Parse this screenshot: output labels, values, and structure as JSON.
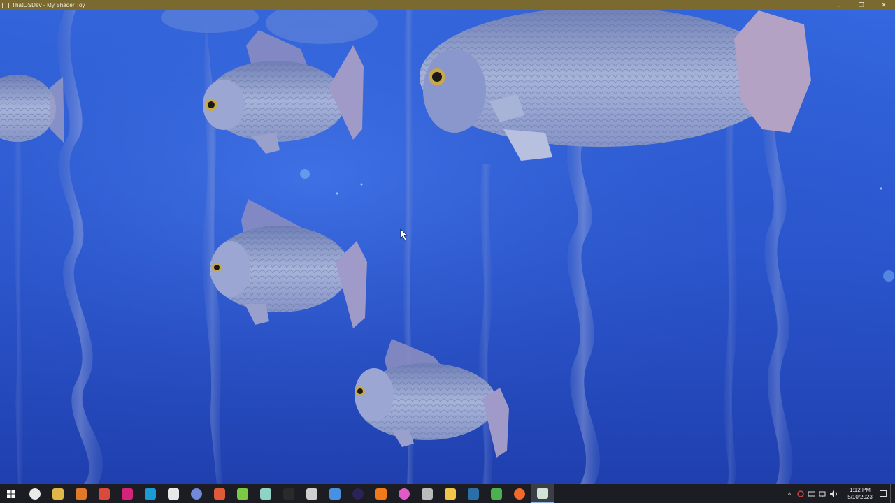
{
  "window": {
    "title": "ThatOSDev - My Shader Toy",
    "minimize_glyph": "–",
    "maximize_glyph": "❐",
    "close_glyph": "✕"
  },
  "scene": {
    "description_icon": "underwater-fish-shader",
    "colors": {
      "water_top": "#2f5ed8",
      "water_bottom": "#1e3fa8",
      "fish_body": "#7e8fc2",
      "fish_eye": "#c8a94a"
    }
  },
  "taskbar": {
    "start_icon": "windows-icon",
    "apps": [
      {
        "name": "obs-icon",
        "color": "#e9e9e9"
      },
      {
        "name": "pencil-app-icon",
        "color": "#e0b84a"
      },
      {
        "name": "blender-icon",
        "color": "#e07a2a"
      },
      {
        "name": "paint-app-icon",
        "color": "#d94a3a"
      },
      {
        "name": "m-app-icon",
        "color": "#d4237a"
      },
      {
        "name": "v-app-icon",
        "color": "#1c9ad6"
      },
      {
        "name": "excel-icon",
        "color": "#e8e8e8"
      },
      {
        "name": "discord-icon",
        "color": "#7289da"
      },
      {
        "name": "git-icon",
        "color": "#e05a3a"
      },
      {
        "name": "notepad-icon",
        "color": "#7ac843"
      },
      {
        "name": "cube-app-icon",
        "color": "#8fd3c7"
      },
      {
        "name": "terminal-icon",
        "color": "#2a2a2a"
      },
      {
        "name": "inkscape-icon",
        "color": "#cfcfcf"
      },
      {
        "name": "cmake-icon",
        "color": "#4a90e2"
      },
      {
        "name": "eclipse-icon",
        "color": "#2c2255"
      },
      {
        "name": "flame-app-icon",
        "color": "#f07a1a"
      },
      {
        "name": "color-wheel-icon",
        "color": "#e05ac8"
      },
      {
        "name": "game-controller-icon",
        "color": "#bbbbbb"
      },
      {
        "name": "file-explorer-icon",
        "color": "#f2c649"
      },
      {
        "name": "steam-icon",
        "color": "#2a6fa8"
      },
      {
        "name": "tiles-app-icon",
        "color": "#4caf50"
      },
      {
        "name": "firefox-icon",
        "color": "#f2692a"
      },
      {
        "name": "shader-window-icon",
        "color": "#cfe4d6",
        "active": true
      }
    ],
    "tray": {
      "chevron": "˄",
      "time": "1:12 PM",
      "date": "5/10/2023"
    }
  }
}
